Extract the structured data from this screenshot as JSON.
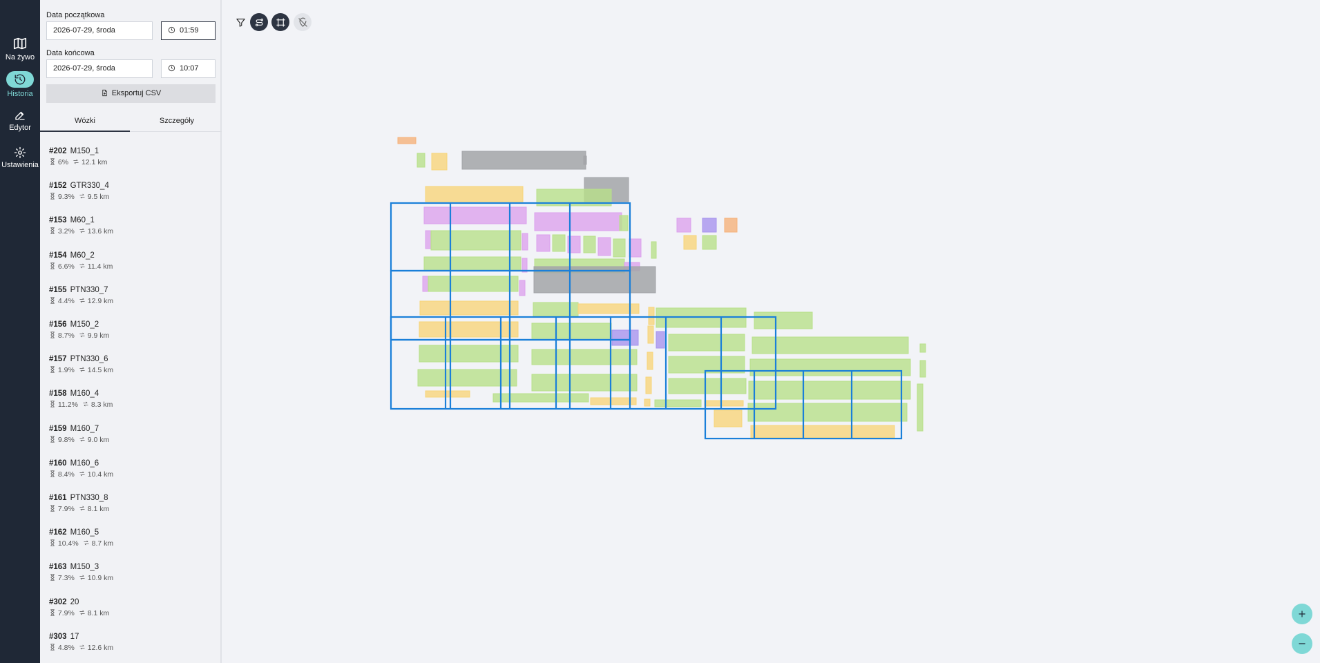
{
  "nav": {
    "items": [
      {
        "label": "Na żywo",
        "icon": "map-icon"
      },
      {
        "label": "Historia",
        "icon": "history-icon"
      },
      {
        "label": "Edytor",
        "icon": "edit-icon"
      },
      {
        "label": "Ustawienia",
        "icon": "gear-icon"
      }
    ],
    "active": "Historia"
  },
  "filters": {
    "start_label": "Data początkowa",
    "start_date": "2026-07-29, środa",
    "start_time": "01:59",
    "end_label": "Data końcowa",
    "end_date": "2026-07-29, środa",
    "end_time": "10:07",
    "export_label": "Eksportuj CSV"
  },
  "tabs": [
    "Wózki",
    "Szczegóły"
  ],
  "active_tab": "Wózki",
  "carts": [
    {
      "id": "#202",
      "name": "M150_1",
      "pct": "6%",
      "km": "12.1 km"
    },
    {
      "id": "#152",
      "name": "GTR330_4",
      "pct": "9.3%",
      "km": "9.5 km"
    },
    {
      "id": "#153",
      "name": "M60_1",
      "pct": "3.2%",
      "km": "13.6 km"
    },
    {
      "id": "#154",
      "name": "M60_2",
      "pct": "6.6%",
      "km": "11.4 km"
    },
    {
      "id": "#155",
      "name": "PTN330_7",
      "pct": "4.4%",
      "km": "12.9 km"
    },
    {
      "id": "#156",
      "name": "M150_2",
      "pct": "8.7%",
      "km": "9.9 km"
    },
    {
      "id": "#157",
      "name": "PTN330_6",
      "pct": "1.9%",
      "km": "14.5 km"
    },
    {
      "id": "#158",
      "name": "M160_4",
      "pct": "11.2%",
      "km": "8.3 km"
    },
    {
      "id": "#159",
      "name": "M160_7",
      "pct": "9.8%",
      "km": "9.0 km"
    },
    {
      "id": "#160",
      "name": "M160_6",
      "pct": "8.4%",
      "km": "10.4 km"
    },
    {
      "id": "#161",
      "name": "PTN330_8",
      "pct": "7.9%",
      "km": "8.1 km"
    },
    {
      "id": "#162",
      "name": "M160_5",
      "pct": "10.4%",
      "km": "8.7 km"
    },
    {
      "id": "#163",
      "name": "M150_3",
      "pct": "7.3%",
      "km": "10.9 km"
    },
    {
      "id": "#302",
      "name": "20",
      "pct": "7.9%",
      "km": "8.1 km"
    },
    {
      "id": "#303",
      "name": "17",
      "pct": "4.8%",
      "km": "12.6 km"
    }
  ],
  "toolbar": {
    "icons": [
      "filter-icon",
      "route-toggle-icon",
      "frame-toggle-icon",
      "hide-location-icon"
    ]
  },
  "zoom": {
    "in_icon": "plus-icon",
    "out_icon": "minus-icon"
  },
  "colors": {
    "rail_bg": "#1f2836",
    "accent": "#7fd8d6",
    "zone_yellow": "#f7d57a",
    "zone_green": "#b8e08a",
    "zone_pink": "#dca2ec",
    "zone_gray": "#a3a4a8",
    "zone_orange": "#f5b27a",
    "zone_purple": "#a793ee",
    "grid_blue": "#1a7fd9"
  }
}
